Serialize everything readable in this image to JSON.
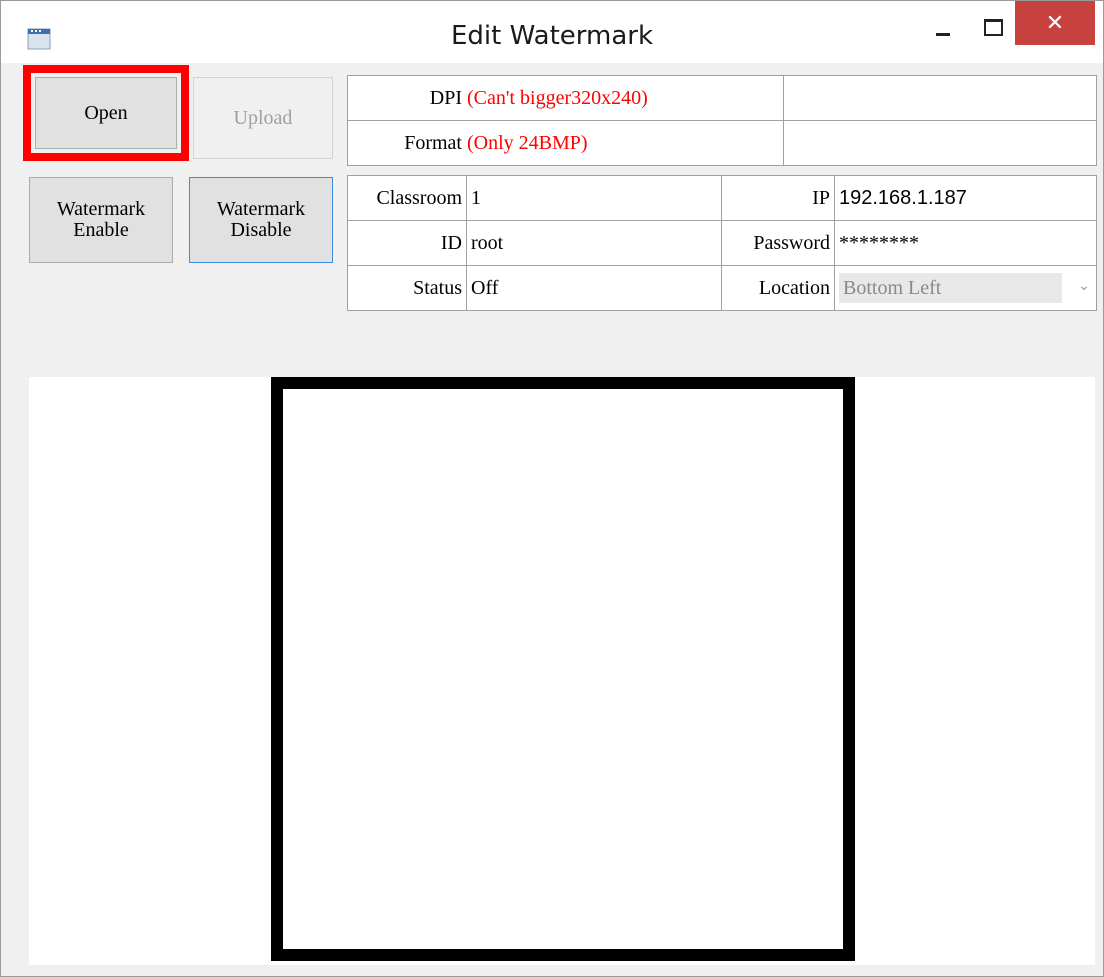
{
  "window": {
    "title": "Edit Watermark",
    "close_glyph": "✕"
  },
  "buttons": {
    "open": "Open",
    "upload": "Upload",
    "watermark_enable": "Watermark Enable",
    "watermark_disable": "Watermark Disable"
  },
  "image_info": {
    "dpi_label": "DPI",
    "dpi_note": "(Can't bigger320x240)",
    "dpi_value": "",
    "format_label": "Format",
    "format_note": "(Only 24BMP)",
    "format_value": ""
  },
  "settings": {
    "classroom_label": "Classroom",
    "classroom_value": "1",
    "ip_label": "IP",
    "ip_value": "192.168.1.187",
    "id_label": "ID",
    "id_value": "root",
    "password_label": "Password",
    "password_value": "********",
    "status_label": "Status",
    "status_value": "Off",
    "location_label": "Location",
    "location_value": "Bottom Left"
  },
  "colors": {
    "highlight": "#ff0000",
    "note_text": "#ff0000",
    "close_button": "#c7413e"
  },
  "icons": [
    "app-icon",
    "minimize-icon",
    "maximize-icon",
    "close-icon",
    "chevron-down-icon"
  ]
}
